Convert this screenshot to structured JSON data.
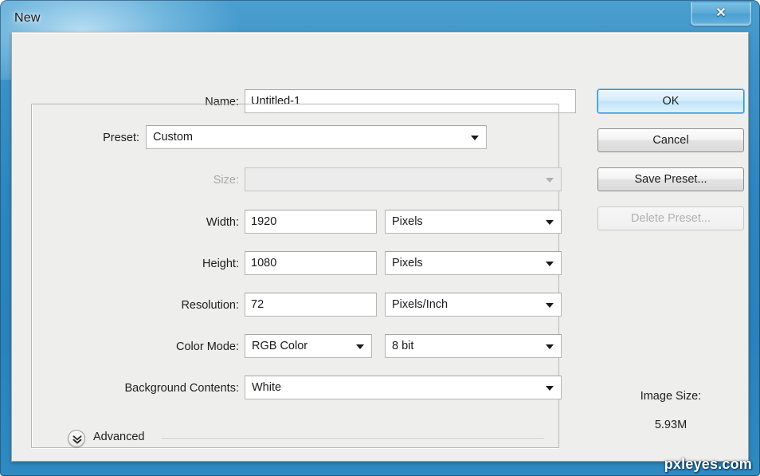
{
  "window": {
    "title": "New",
    "close_glyph": "✕"
  },
  "form": {
    "name": {
      "label": "Name:",
      "value": "Untitled-1"
    },
    "preset": {
      "label": "Preset:",
      "value": "Custom"
    },
    "size": {
      "label": "Size:",
      "value": "",
      "disabled": true
    },
    "width": {
      "label": "Width:",
      "value": "1920",
      "unit": "Pixels"
    },
    "height": {
      "label": "Height:",
      "value": "1080",
      "unit": "Pixels"
    },
    "resolution": {
      "label": "Resolution:",
      "value": "72",
      "unit": "Pixels/Inch"
    },
    "color_mode": {
      "label": "Color Mode:",
      "value": "RGB Color",
      "depth": "8 bit"
    },
    "background_contents": {
      "label": "Background Contents:",
      "value": "White"
    },
    "advanced": {
      "label": "Advanced"
    }
  },
  "buttons": {
    "ok": "OK",
    "cancel": "Cancel",
    "save_preset": "Save Preset...",
    "delete_preset": "Delete Preset..."
  },
  "image_size": {
    "label": "Image Size:",
    "value": "5.93M"
  },
  "watermark": "pxleyes.com",
  "colors": {
    "frame_blue": "#2d86bf",
    "dialog_bg": "#eeeeec",
    "focus_blue": "#2f8fd0",
    "text": "#1d1d1d",
    "disabled_text": "#b0b0b0"
  }
}
